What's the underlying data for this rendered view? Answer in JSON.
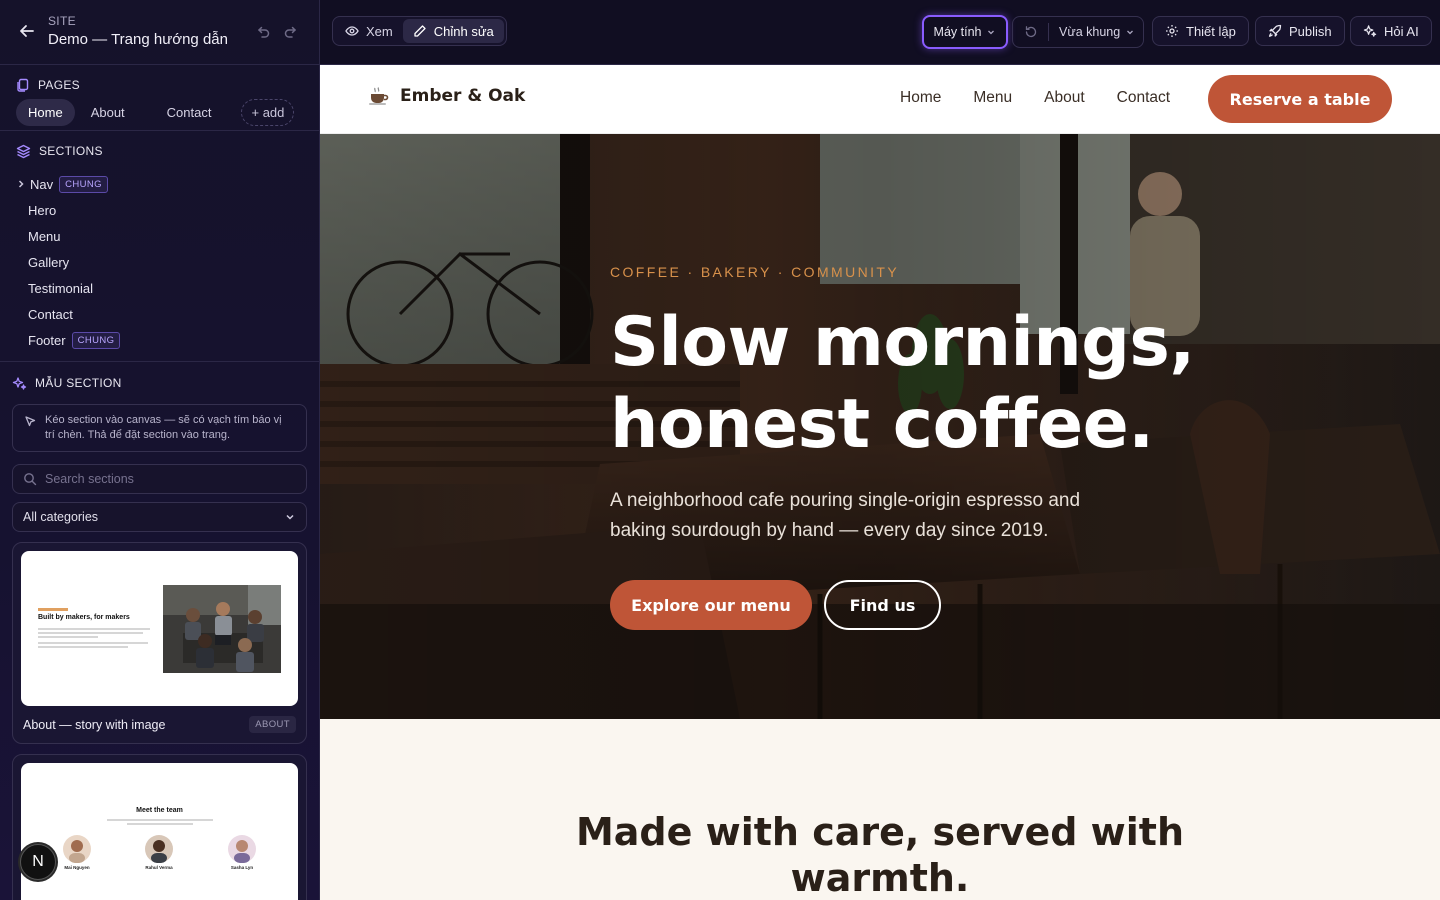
{
  "site": {
    "label": "SITE",
    "name": "Demo — Trang hướng dẫn"
  },
  "pages": {
    "heading": "PAGES",
    "items": [
      "Home",
      "About",
      "Contact"
    ],
    "active": "Home",
    "add_label": "+ add"
  },
  "sections": {
    "heading": "SECTIONS",
    "items": [
      {
        "label": "Nav",
        "badge": "CHUNG"
      },
      {
        "label": "Hero"
      },
      {
        "label": "Menu"
      },
      {
        "label": "Gallery"
      },
      {
        "label": "Testimonial"
      },
      {
        "label": "Contact"
      },
      {
        "label": "Footer",
        "badge": "CHUNG"
      }
    ]
  },
  "templates": {
    "heading": "MẪU SECTION",
    "hint": "Kéo section vào canvas — sẽ có vạch tím báo vị trí chèn. Thả để đặt section vào trang.",
    "search_placeholder": "Search sections",
    "category": "All categories",
    "cards": [
      {
        "title": "About — story with image",
        "tag": "ABOUT",
        "preview_heading": "Built by makers, for makers"
      },
      {
        "preview_heading": "Meet the team",
        "people": [
          "Mai Nguyen",
          "Rahul Verma",
          "Sasha Lyn"
        ]
      }
    ]
  },
  "toolbar": {
    "view_label": "Xem",
    "edit_label": "Chỉnh sửa",
    "device": "Máy tính",
    "fit": "Vừa khung",
    "settings": "Thiết lập",
    "publish": "Publish",
    "ai": "Hỏi AI"
  },
  "preview": {
    "brand": "Ember & Oak",
    "brand_icon": "coffee-cup-icon",
    "nav": [
      "Home",
      "Menu",
      "About",
      "Contact"
    ],
    "cta": "Reserve a table",
    "eyebrow": "COFFEE · BAKERY · COMMUNITY",
    "headline_1": "Slow mornings,",
    "headline_2": "honest coffee.",
    "lead": "A neighborhood cafe pouring single-origin espresso and baking sourdough by hand — every day since 2019.",
    "primary_btn": "Explore our menu",
    "secondary_btn": "Find us",
    "story_heading": "Made with care, served with warmth."
  },
  "colors": {
    "accent": "#8a5cff",
    "brand": "#bf5537",
    "eyebrow": "#d8914b",
    "panel": "#15122a"
  },
  "assistant_badge": "N"
}
